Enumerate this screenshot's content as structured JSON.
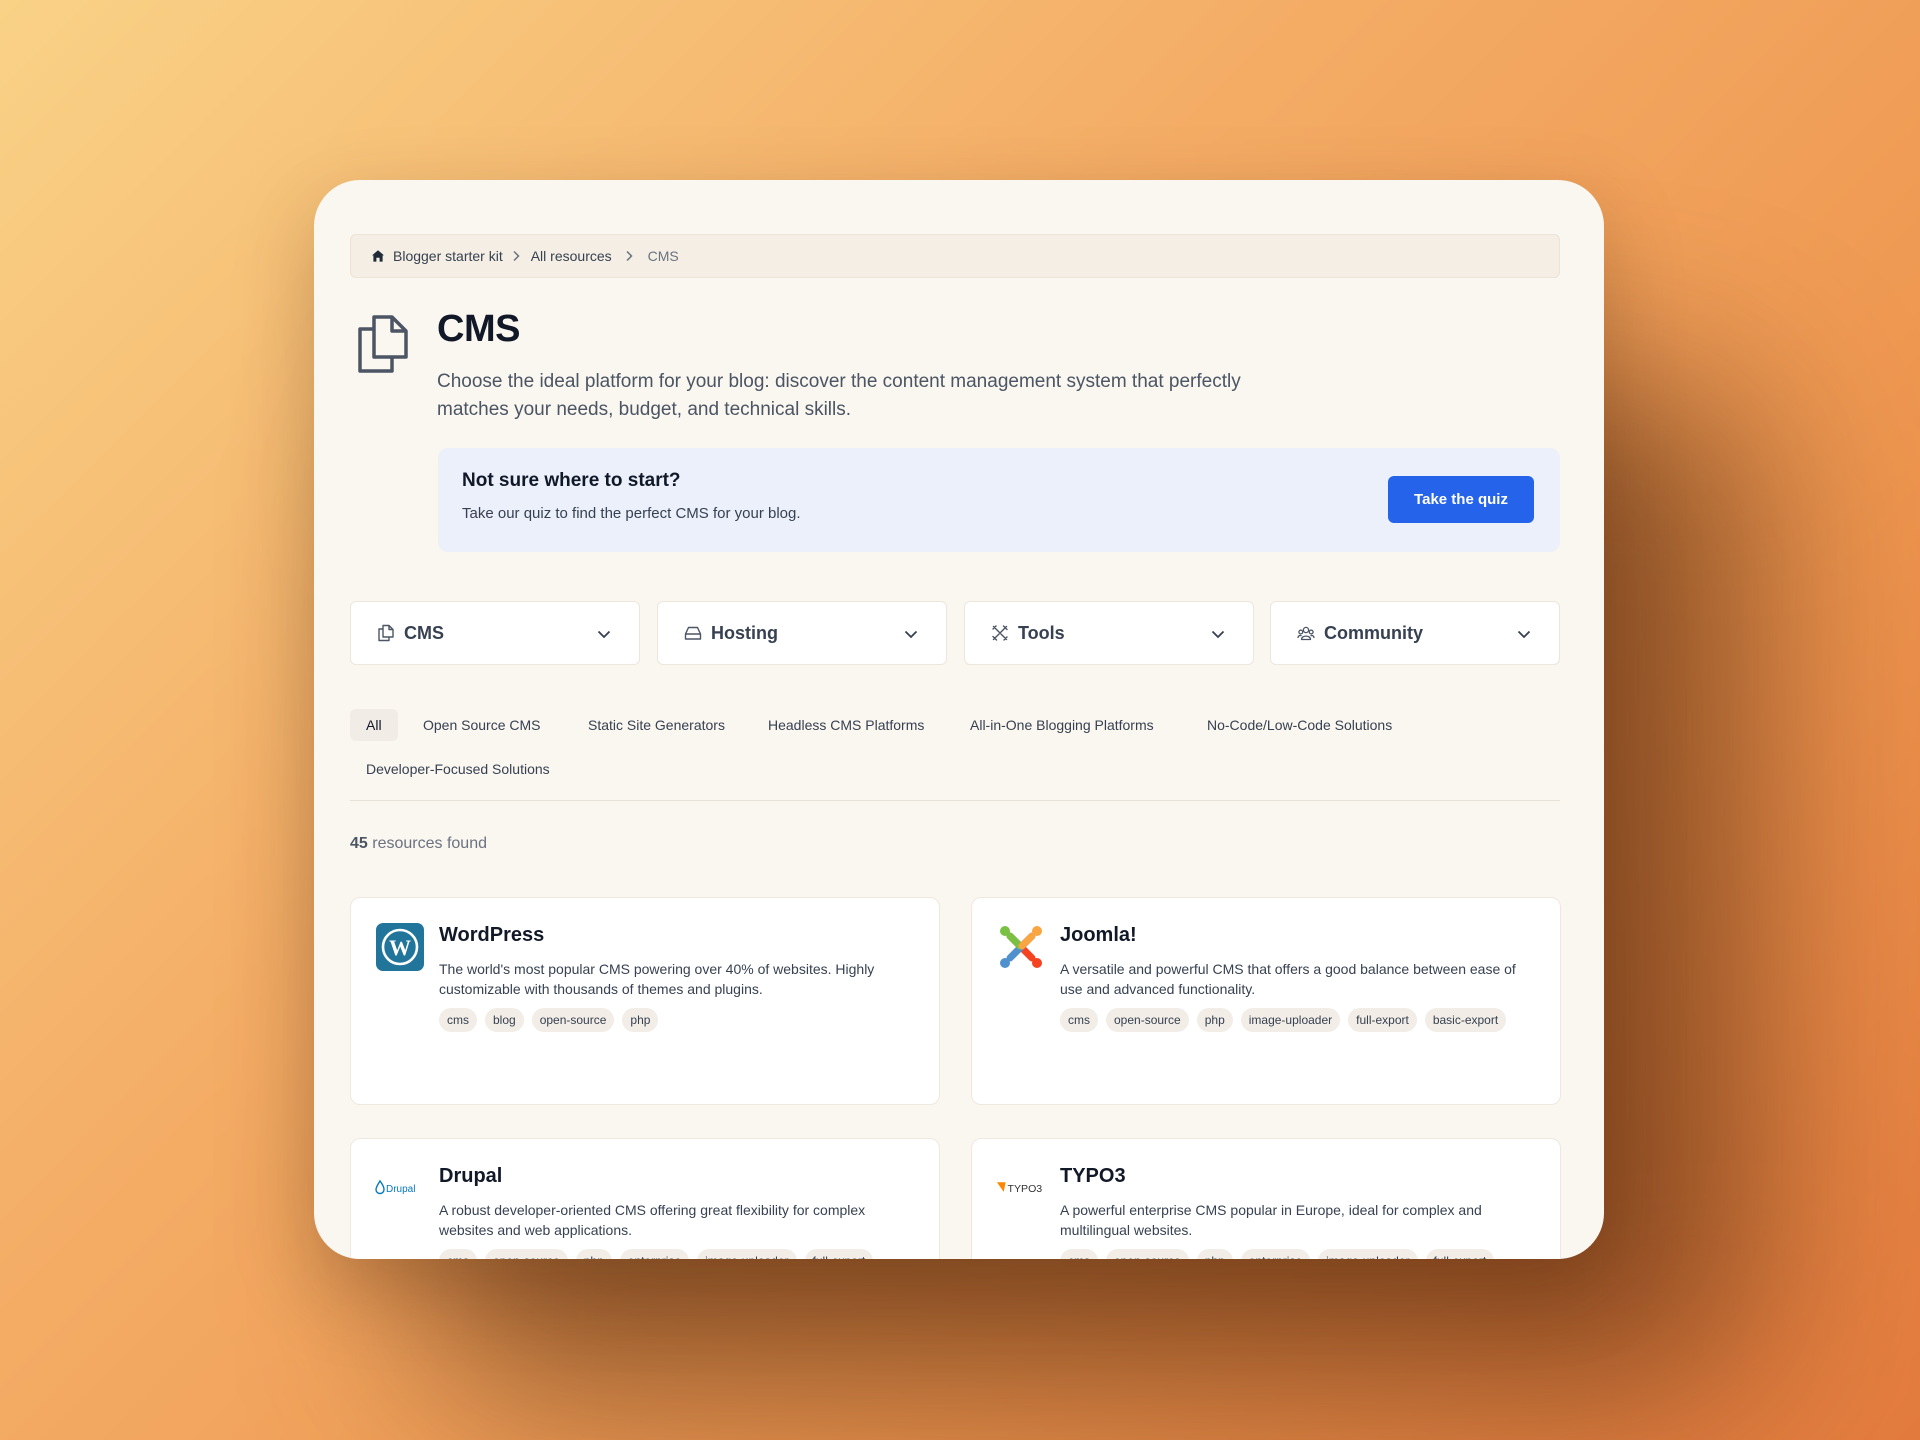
{
  "breadcrumb": {
    "items": [
      "Blogger starter kit",
      "All resources"
    ],
    "current": "CMS"
  },
  "header": {
    "title": "CMS",
    "description": "Choose the ideal platform for your blog: discover the content management system that perfectly matches your needs, budget, and technical skills."
  },
  "quiz": {
    "title": "Not sure where to start?",
    "subtitle": "Take our quiz to find the perfect CMS for your blog.",
    "button_label": "Take the quiz",
    "accent_color": "#2563eb"
  },
  "dropdowns": [
    {
      "label": "CMS",
      "icon": "documents-icon"
    },
    {
      "label": "Hosting",
      "icon": "server-icon"
    },
    {
      "label": "Tools",
      "icon": "tools-icon"
    },
    {
      "label": "Community",
      "icon": "users-icon"
    }
  ],
  "filters": {
    "active": "All",
    "items": [
      "All",
      "Open Source CMS",
      "Static Site Generators",
      "Headless CMS Platforms",
      "All-in-One Blogging Platforms",
      "No-Code/Low-Code Solutions",
      "Developer-Focused Solutions"
    ]
  },
  "results": {
    "count": "45",
    "suffix": "resources found"
  },
  "cards": [
    {
      "name": "WordPress",
      "logo": "wordpress-logo",
      "description": "The world's most popular CMS powering over 40% of websites. Highly customizable with thousands of themes and plugins.",
      "tags": [
        "cms",
        "blog",
        "open-source",
        "php"
      ]
    },
    {
      "name": "Joomla!",
      "logo": "joomla-logo",
      "description": "A versatile and powerful CMS that offers a good balance between ease of use and advanced functionality.",
      "tags": [
        "cms",
        "open-source",
        "php",
        "image-uploader",
        "full-export",
        "basic-export"
      ]
    },
    {
      "name": "Drupal",
      "logo": "drupal-logo",
      "logo_text": "Drupal",
      "description": "A robust developer-oriented CMS offering great flexibility for complex websites and web applications.",
      "tags": [
        "cms",
        "open-source",
        "php",
        "enterprise",
        "image-uploader",
        "full-export"
      ]
    },
    {
      "name": "TYPO3",
      "logo": "typo3-logo",
      "logo_text": "TYPO3",
      "description": "A powerful enterprise CMS popular in Europe, ideal for complex and multilingual websites.",
      "tags": [
        "cms",
        "open-source",
        "php",
        "enterprise",
        "image-uploader",
        "full-export"
      ]
    }
  ]
}
